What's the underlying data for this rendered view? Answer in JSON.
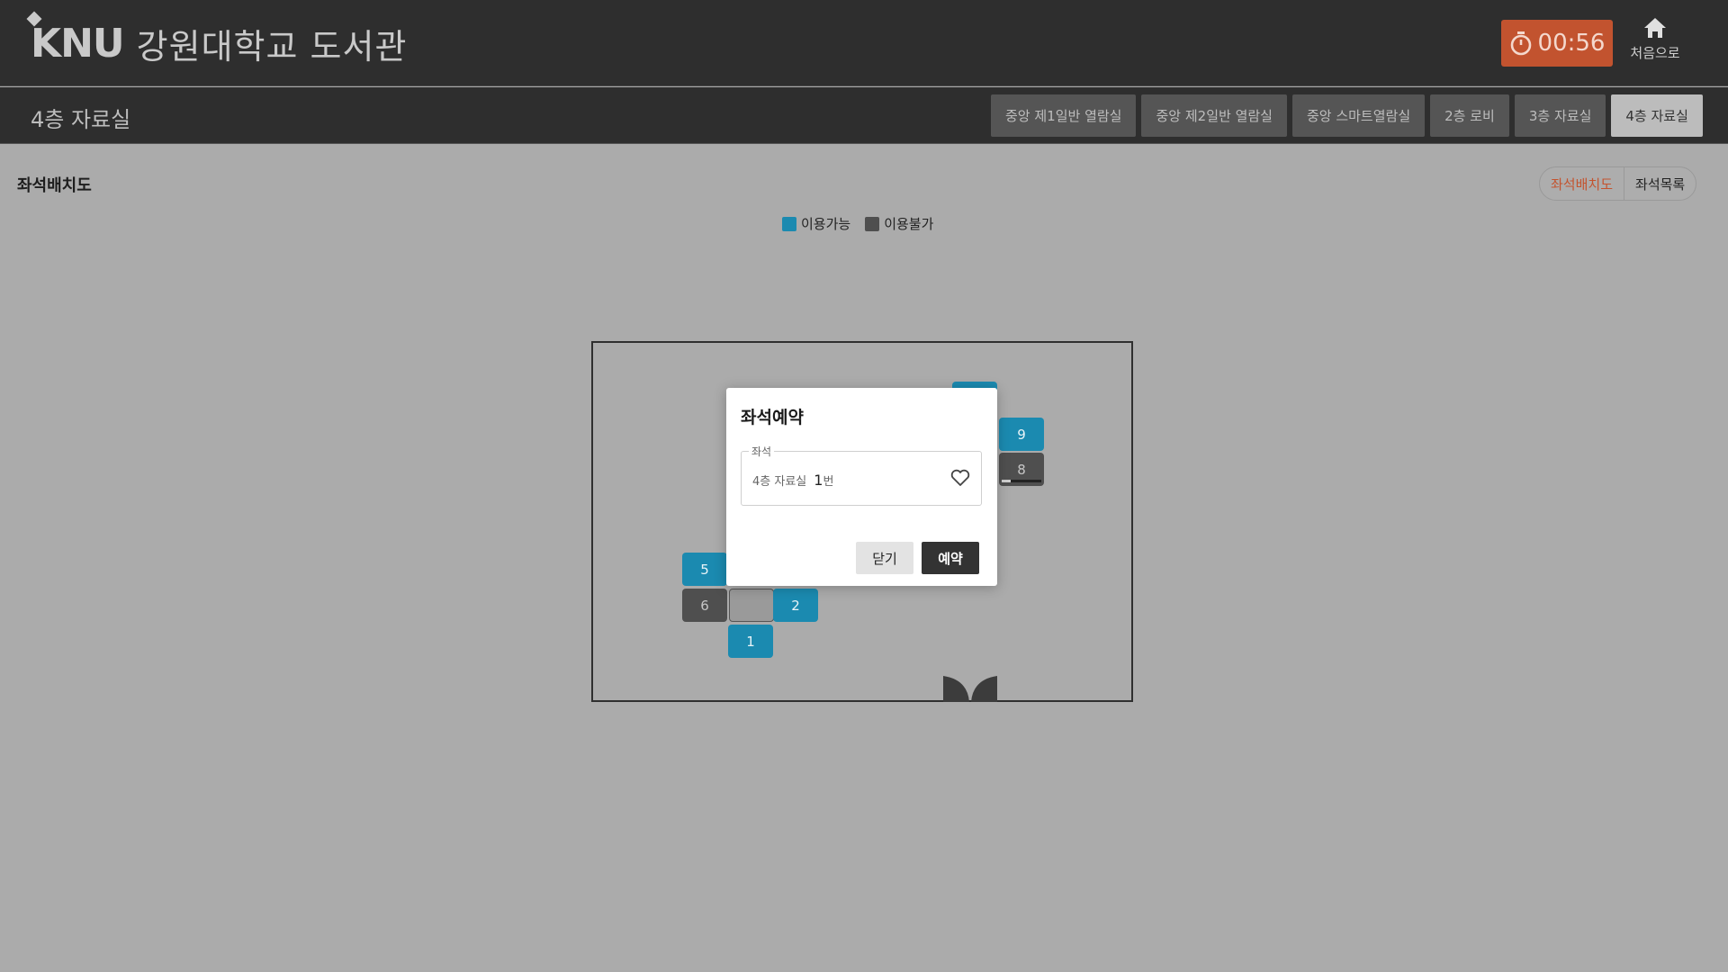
{
  "header": {
    "logo_mark": "KNU",
    "logo_text": "강원대학교 도서관",
    "timer": "00:56",
    "home_label": "처음으로"
  },
  "subbar": {
    "room_title": "4층 자료실",
    "tabs": [
      {
        "label": "중앙 제1일반 열람실",
        "active": false
      },
      {
        "label": "중앙 제2일반 열람실",
        "active": false
      },
      {
        "label": "중앙 스마트열람실",
        "active": false
      },
      {
        "label": "2층 로비",
        "active": false
      },
      {
        "label": "3층 자료실",
        "active": false
      },
      {
        "label": "4층 자료실",
        "active": true
      }
    ]
  },
  "content": {
    "section_title": "좌석배치도",
    "view_toggle": {
      "map": "좌석배치도",
      "list": "좌석목록"
    },
    "legend": {
      "available": "이용가능",
      "unavailable": "이용불가"
    }
  },
  "colors": {
    "available": "#1b8ab0",
    "unavailable": "#4f4f4f",
    "timer": "#c2532f",
    "accent": "#c4532e"
  },
  "seats": [
    {
      "label": "9",
      "status": "available"
    },
    {
      "label": "8",
      "status": "unavailable"
    },
    {
      "label": "5",
      "status": "available"
    },
    {
      "label": "6",
      "status": "unavailable"
    },
    {
      "label": "2",
      "status": "available"
    },
    {
      "label": "1",
      "status": "available"
    }
  ],
  "modal": {
    "title": "좌석예약",
    "field_label": "좌석",
    "room": "4층 자료실",
    "seat_number": "1",
    "seat_unit": "번",
    "close_label": "닫기",
    "reserve_label": "예약"
  }
}
